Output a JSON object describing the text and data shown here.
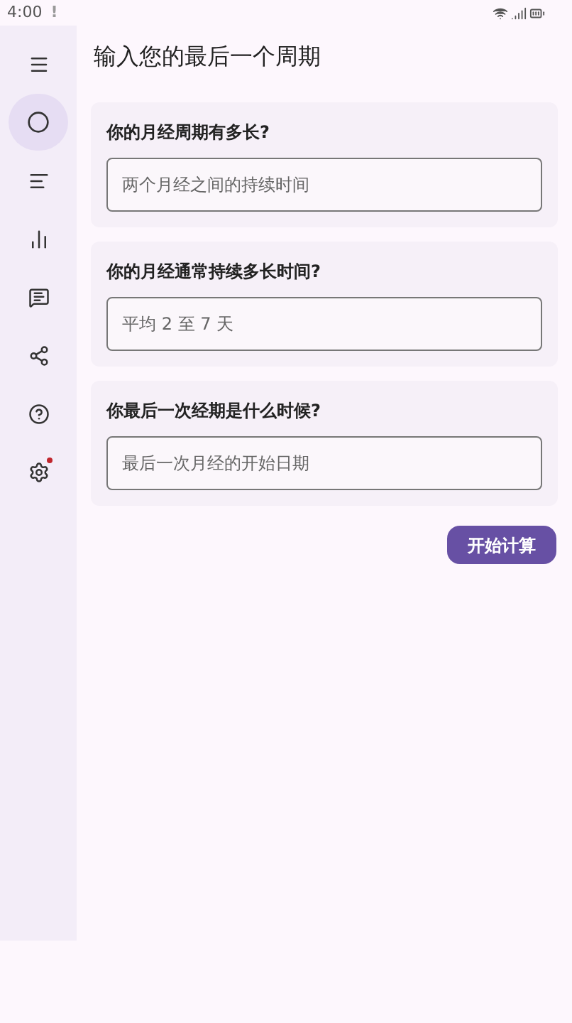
{
  "status_bar": {
    "time": "4:00",
    "alert": "!"
  },
  "nav": [
    {
      "selected": false,
      "badge": false
    },
    {
      "selected": true,
      "badge": false
    },
    {
      "selected": false,
      "badge": false
    },
    {
      "selected": false,
      "badge": false
    },
    {
      "selected": false,
      "badge": false
    },
    {
      "selected": false,
      "badge": false
    },
    {
      "selected": false,
      "badge": false
    },
    {
      "selected": false,
      "badge": true
    }
  ],
  "title": "输入您的最后一个周期",
  "questions": [
    {
      "label": "你的月经周期有多长?",
      "placeholder": "两个月经之间的持续时间"
    },
    {
      "label": "你的月经通常持续多长时间?",
      "placeholder": "平均 2 至 7 天"
    },
    {
      "label": "你最后一次经期是什么时候?",
      "placeholder": "最后一次月经的开始日期"
    }
  ],
  "button": "开始计算"
}
